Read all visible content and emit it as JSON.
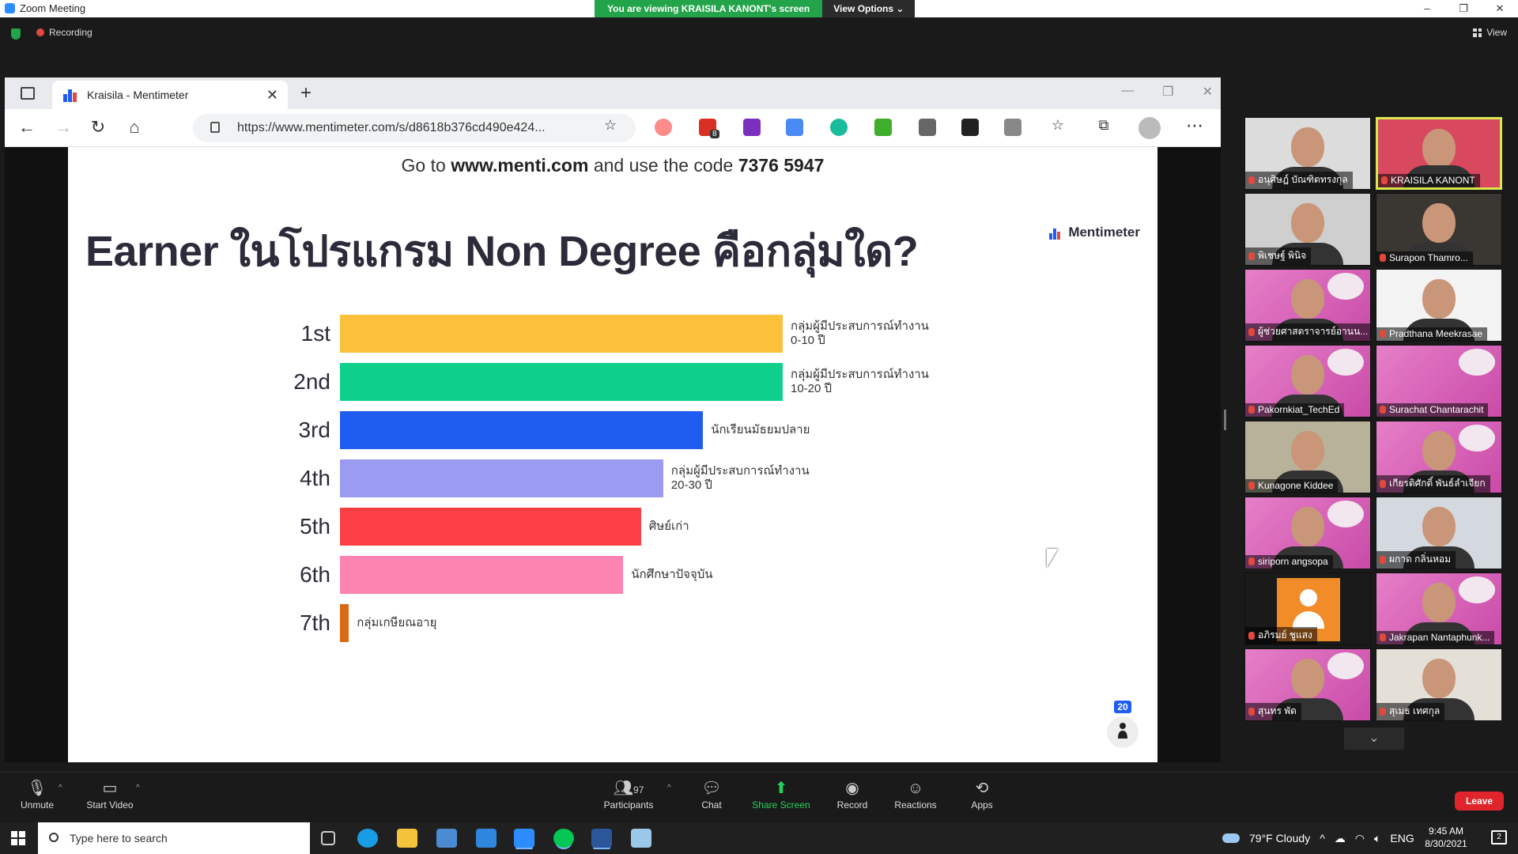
{
  "window": {
    "title": "Zoom Meeting",
    "viewing_banner": "You are viewing KRAISILA KANONT's screen",
    "view_options": "View Options",
    "recording": "Recording",
    "view": "View",
    "minimize": "–",
    "restore": "❐",
    "close": "✕"
  },
  "browser": {
    "tab_title": "Kraisila - Mentimeter",
    "url": "https://www.mentimeter.com/s/d8618b376cd490e424...",
    "extension_badge": "8"
  },
  "slide": {
    "go_prefix": "Go to",
    "go_site": "www.menti.com",
    "go_mid": "and use the code",
    "go_code": "7376 5947",
    "question": "Earner ในโปรแกรม Non Degree คือกลุ่มใด?",
    "logo_text": "Mentimeter",
    "participants_count": "20"
  },
  "chart_data": {
    "type": "bar",
    "orientation": "horizontal",
    "categories": [
      "1st",
      "2nd",
      "3rd",
      "4th",
      "5th",
      "6th",
      "7th"
    ],
    "labels": [
      [
        "กลุ่มผู้มีประสบการณ์ทำงาน",
        "0-10 ปี"
      ],
      [
        "กลุ่มผู้มีประสบการณ์ทำงาน",
        "10-20 ปี"
      ],
      [
        "นักเรียนมัธยมปลาย"
      ],
      [
        "กลุ่มผู้มีประสบการณ์ทำงาน",
        "20-30 ปี"
      ],
      [
        "ศิษย์เก่า"
      ],
      [
        "นักศึกษาปัจจุบัน"
      ],
      [
        "กลุ่มเกษียณอายุ"
      ]
    ],
    "values": [
      1.0,
      1.0,
      0.82,
      0.73,
      0.68,
      0.64,
      0.02
    ],
    "colors": [
      "#fbc13a",
      "#0fd08a",
      "#1f5cf0",
      "#9b9bf2",
      "#fb3f45",
      "#fd83b0",
      "#d86a12"
    ]
  },
  "gallery": [
    {
      "name": "อนุศิษฎ์ บัณฑิตทรงกุล",
      "style": "plain",
      "bg": "#dcdcdc"
    },
    {
      "name": "KRAISILA KANONT",
      "style": "active",
      "bg": "#d8485f"
    },
    {
      "name": "พิเชษฐ์ พินิจ",
      "style": "plain",
      "bg": "#cfcfcf"
    },
    {
      "name": "Surapon Thamro...",
      "style": "plain",
      "bg": "#3a3632"
    },
    {
      "name": "ผู้ช่วยศาสตราจารย์อานน...",
      "style": "pink",
      "bg": ""
    },
    {
      "name": "Pradthana Meekrasae",
      "style": "plain",
      "bg": "#f3f3f3"
    },
    {
      "name": "Pakornkiat_TechEd",
      "style": "pink",
      "bg": ""
    },
    {
      "name": "Surachat Chantarachit",
      "style": "pink-empty",
      "bg": ""
    },
    {
      "name": "Kunagone Kiddee",
      "style": "plain",
      "bg": "#b9b29a"
    },
    {
      "name": "เกียรติศักดิ์ พันธ์ลำเจียก",
      "style": "pink",
      "bg": ""
    },
    {
      "name": "siriporn angsopa",
      "style": "pink",
      "bg": ""
    },
    {
      "name": "ผกาด กลิ่นหอม",
      "style": "plain",
      "bg": "#d4d9e0"
    },
    {
      "name": "อภิรมย์ ชูแสง",
      "style": "avatar",
      "bg": "#1a1a1a"
    },
    {
      "name": "Jakrapan Nantaphunk...",
      "style": "pink",
      "bg": ""
    },
    {
      "name": "สุนทร พัด",
      "style": "pink",
      "bg": ""
    },
    {
      "name": "สุเมธ เทศกุล",
      "style": "plain",
      "bg": "#e4e0d8"
    }
  ],
  "toolbar": {
    "unmute": "Unmute",
    "start_video": "Start Video",
    "participants": "Participants",
    "participants_count": "97",
    "chat": "Chat",
    "share_screen": "Share Screen",
    "record": "Record",
    "reactions": "Reactions",
    "apps": "Apps",
    "leave": "Leave"
  },
  "taskbar": {
    "search_placeholder": "Type here to search",
    "weather": "79°F  Cloudy",
    "lang": "ENG",
    "time": "9:45 AM",
    "date": "8/30/2021",
    "notifications": "2"
  }
}
